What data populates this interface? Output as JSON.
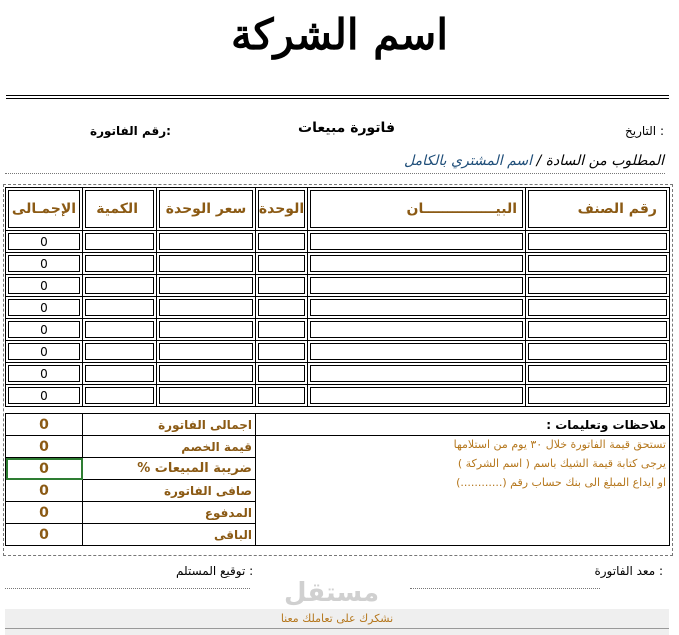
{
  "company_name": "اسم الشركة",
  "header": {
    "date_label": "التاريخ :",
    "title": "فاتورة مبيعات",
    "invoice_no_label": "رقم الفاتورة:"
  },
  "customer": {
    "requested_label": "المطلوب من السادة /",
    "customer_placeholder": "اسم المشتري بالكامل"
  },
  "columns": [
    "رقم الصنف",
    "البيـــــــــــــــان",
    "الوحدة",
    "سعر الوحدة",
    "الكمية",
    "الإجمـالى"
  ],
  "rows": [
    {
      "total": "0"
    },
    {
      "total": "0"
    },
    {
      "total": "0"
    },
    {
      "total": "0"
    },
    {
      "total": "0"
    },
    {
      "total": "0"
    },
    {
      "total": "0"
    },
    {
      "total": "0"
    }
  ],
  "summary": [
    {
      "label": "اجمالى الفاتورة",
      "value": "0"
    },
    {
      "label": "قيمة الخصم",
      "value": "0"
    },
    {
      "label": "ضريبة المبيعات %",
      "value": "0"
    },
    {
      "label": "صافى الفاتورة",
      "value": "0"
    },
    {
      "label": "المدفوع",
      "value": "0"
    },
    {
      "label": "الباقى",
      "value": "0"
    }
  ],
  "notes": {
    "title": "ملاحظات وتعليمات :",
    "lines": [
      "تستحق قيمة الفاتورة خلال ٣٠ يوم من استلامها",
      "يرجى كتابة قيمة الشيك باسم ( اسم الشركة )",
      "او ايداع المبلغ الى بنك حساب رقم (............)"
    ]
  },
  "signatures": {
    "prepared_by": "معد الفاتورة :",
    "received_by": "توقيع المستلم :"
  },
  "footer": {
    "thanks": "نشكرك على تعاملك معنا",
    "watermark": "مستقل"
  },
  "colors": {
    "accent": "#8b5a14",
    "notes_text": "#b5771d",
    "customer_text": "#1f4e79"
  }
}
